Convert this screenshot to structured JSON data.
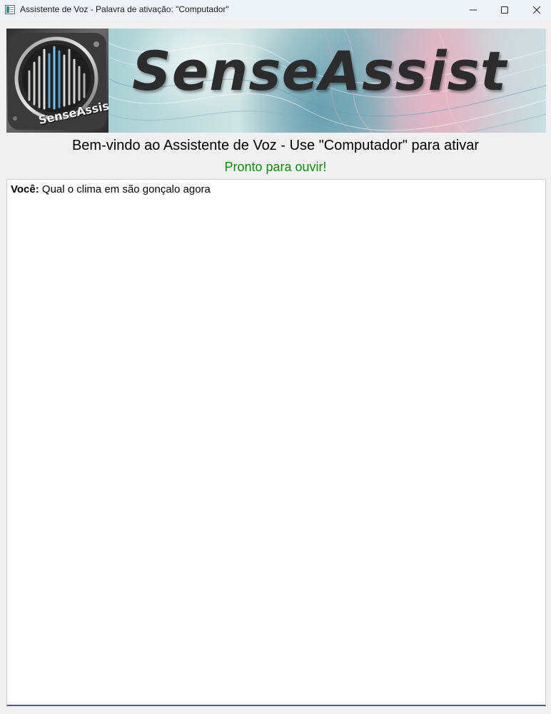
{
  "window": {
    "title": "Assistente de Voz - Palavra de ativação: \"Computador\"",
    "controls": [
      "minimize-icon",
      "maximize-icon",
      "close-icon"
    ]
  },
  "banner": {
    "logo_text": "SenseAssist",
    "title": "SenseAssist"
  },
  "header": {
    "welcome": "Bem-vindo ao Assistente de Voz - Use \"Computador\" para ativar",
    "status": "Pronto para ouvir!",
    "status_color": "#0a8a0a"
  },
  "chat": {
    "messages": [
      {
        "speaker": "Você:",
        "text": "Qual o clima em são gonçalo agora"
      }
    ]
  }
}
